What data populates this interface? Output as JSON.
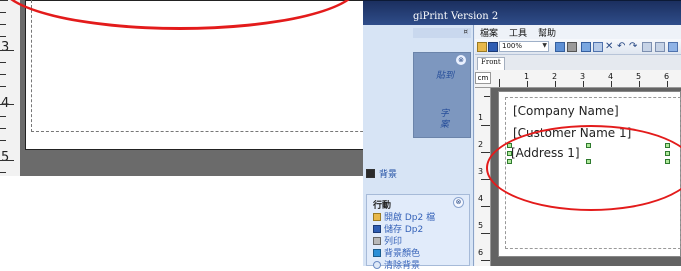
{
  "left_panel": {
    "ruler_numbers": [
      "3",
      "4",
      "5"
    ]
  },
  "window": {
    "title": "giPrint Version 2",
    "pane_header_symbol": "¤",
    "upper_group_toggle": "⊗",
    "upper_fragments": [
      "貼到",
      "字",
      "案"
    ],
    "background_item": "背景",
    "actions": {
      "title": "行動",
      "toggle": "⊗",
      "items": [
        "開啟 Dp2 檔",
        "儲存 Dp2",
        "列印",
        "背景顏色",
        "清除背景"
      ]
    },
    "menu": [
      "檔案",
      "工具",
      "幫助"
    ],
    "zoom": "100%",
    "tab": "Front",
    "ruler": {
      "unit": "cm",
      "numbers": [
        "1",
        "2",
        "3",
        "4",
        "5",
        "6"
      ],
      "side_numbers": [
        "1",
        "2",
        "3",
        "4",
        "5",
        "6"
      ]
    },
    "label_fields": [
      "[Company Name]",
      "[Customer Name 1]",
      "[Address 1]"
    ]
  },
  "colors": {
    "highlight_oval": "#e31b1b",
    "title_bar": "#2f4d8a",
    "task_pane": "#d7e4f5",
    "link_text": "#3562b8"
  }
}
